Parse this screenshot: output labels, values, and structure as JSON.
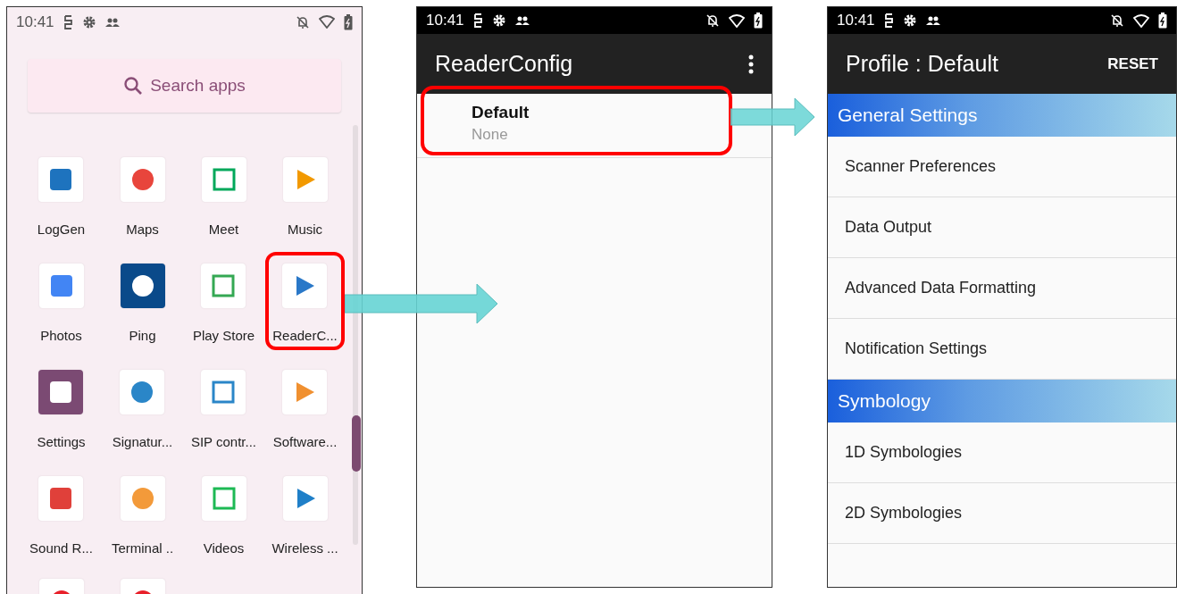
{
  "launcher": {
    "status_time": "10:41",
    "search": {
      "placeholder": "Search apps"
    },
    "apps": [
      {
        "label": "LogGen",
        "highlighted": false
      },
      {
        "label": "Maps",
        "highlighted": false
      },
      {
        "label": "Meet",
        "highlighted": false
      },
      {
        "label": "Music",
        "highlighted": false
      },
      {
        "label": "Photos",
        "highlighted": false
      },
      {
        "label": "Ping",
        "highlighted": false
      },
      {
        "label": "Play Store",
        "highlighted": false
      },
      {
        "label": "ReaderC...",
        "highlighted": true
      },
      {
        "label": "Settings",
        "highlighted": false
      },
      {
        "label": "Signatur...",
        "highlighted": false
      },
      {
        "label": "SIP contr...",
        "highlighted": false
      },
      {
        "label": "Software...",
        "highlighted": false
      },
      {
        "label": "Sound R...",
        "highlighted": false
      },
      {
        "label": "Terminal ..",
        "highlighted": false
      },
      {
        "label": "Videos",
        "highlighted": false
      },
      {
        "label": "Wireless ...",
        "highlighted": false
      }
    ]
  },
  "reader_config": {
    "status_time": "10:41",
    "title": "ReaderConfig",
    "profiles": [
      {
        "name": "Default",
        "description": "None",
        "highlighted": true
      }
    ]
  },
  "profile_settings": {
    "status_time": "10:41",
    "title": "Profile : Default",
    "action": "RESET",
    "sections": [
      {
        "title": "General Settings",
        "items": [
          "Scanner Preferences",
          "Data Output",
          "Advanced Data Formatting",
          "Notification Settings"
        ]
      },
      {
        "title": "Symbology",
        "items": [
          "1D Symbologies",
          "2D Symbologies"
        ]
      }
    ]
  }
}
